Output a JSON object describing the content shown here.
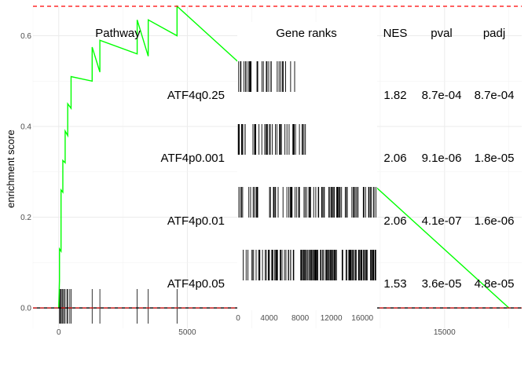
{
  "chart_data": [
    {
      "type": "line",
      "ylabel": "enrichment score",
      "xlim": [
        -1000,
        18000
      ],
      "ylim": [
        -0.045,
        0.665
      ],
      "x_ticks": [
        0,
        5000,
        15000
      ],
      "y_ticks": [
        0.0,
        0.2,
        0.4,
        0.6
      ],
      "x_tick_labels": [
        "0",
        "5000",
        "15000"
      ],
      "y_tick_labels": [
        "0.0",
        "0.2",
        "0.4",
        "0.6"
      ],
      "grid": true,
      "reference_lines": {
        "max_es": 0.665,
        "min_es": 0.0
      },
      "colors": {
        "curve": "#00ff00",
        "reference": "#ff0000",
        "zero": "#000000"
      },
      "series": [
        {
          "x": [
            0,
            30,
            30,
            90,
            90,
            160,
            160,
            250,
            250,
            350,
            350,
            480,
            480,
            1300,
            1300,
            1600,
            1600,
            3050,
            3050,
            3480,
            3480,
            4600,
            4600,
            17500
          ],
          "y": [
            0.0,
            0.06,
            0.13,
            0.125,
            0.26,
            0.255,
            0.325,
            0.32,
            0.39,
            0.38,
            0.45,
            0.44,
            0.51,
            0.5,
            0.575,
            0.52,
            0.59,
            0.56,
            0.635,
            0.555,
            0.635,
            0.6,
            0.665,
            0.0
          ]
        }
      ],
      "hit_positions": [
        30,
        60,
        90,
        130,
        160,
        210,
        250,
        320,
        350,
        430,
        480,
        1300,
        1600,
        3050,
        3480,
        4600
      ]
    },
    {
      "type": "table",
      "headers": {
        "pathway": "Pathway",
        "ranks": "Gene ranks",
        "nes": "NES",
        "pval": "pval",
        "padj": "padj"
      },
      "rows": [
        {
          "pathway": "ATF4q0.25",
          "nes": "1.82",
          "pval": "8.7e-04",
          "padj": "8.7e-04",
          "ranks_density": 0.18,
          "ranks_seed": 11,
          "ranks_max": 7800
        },
        {
          "pathway": "ATF4p0.001",
          "nes": "2.06",
          "pval": "9.1e-06",
          "padj": "1.8e-05",
          "ranks_density": 0.28,
          "ranks_seed": 23,
          "ranks_max": 9000
        },
        {
          "pathway": "ATF4p0.01",
          "nes": "2.06",
          "pval": "4.1e-07",
          "padj": "1.6e-06",
          "ranks_density": 0.55,
          "ranks_seed": 37,
          "ranks_max": 17800
        },
        {
          "pathway": "ATF4p0.05",
          "nes": "1.53",
          "pval": "3.6e-05",
          "padj": "4.8e-05",
          "ranks_density": 0.95,
          "ranks_seed": 53,
          "ranks_max": 17800
        }
      ],
      "ranks_axis": {
        "xlim": [
          0,
          17800
        ],
        "ticks": [
          0,
          4000,
          8000,
          12000,
          16000
        ],
        "tick_labels": [
          "0",
          "4000",
          "8000",
          "12000",
          "16000"
        ]
      }
    }
  ]
}
